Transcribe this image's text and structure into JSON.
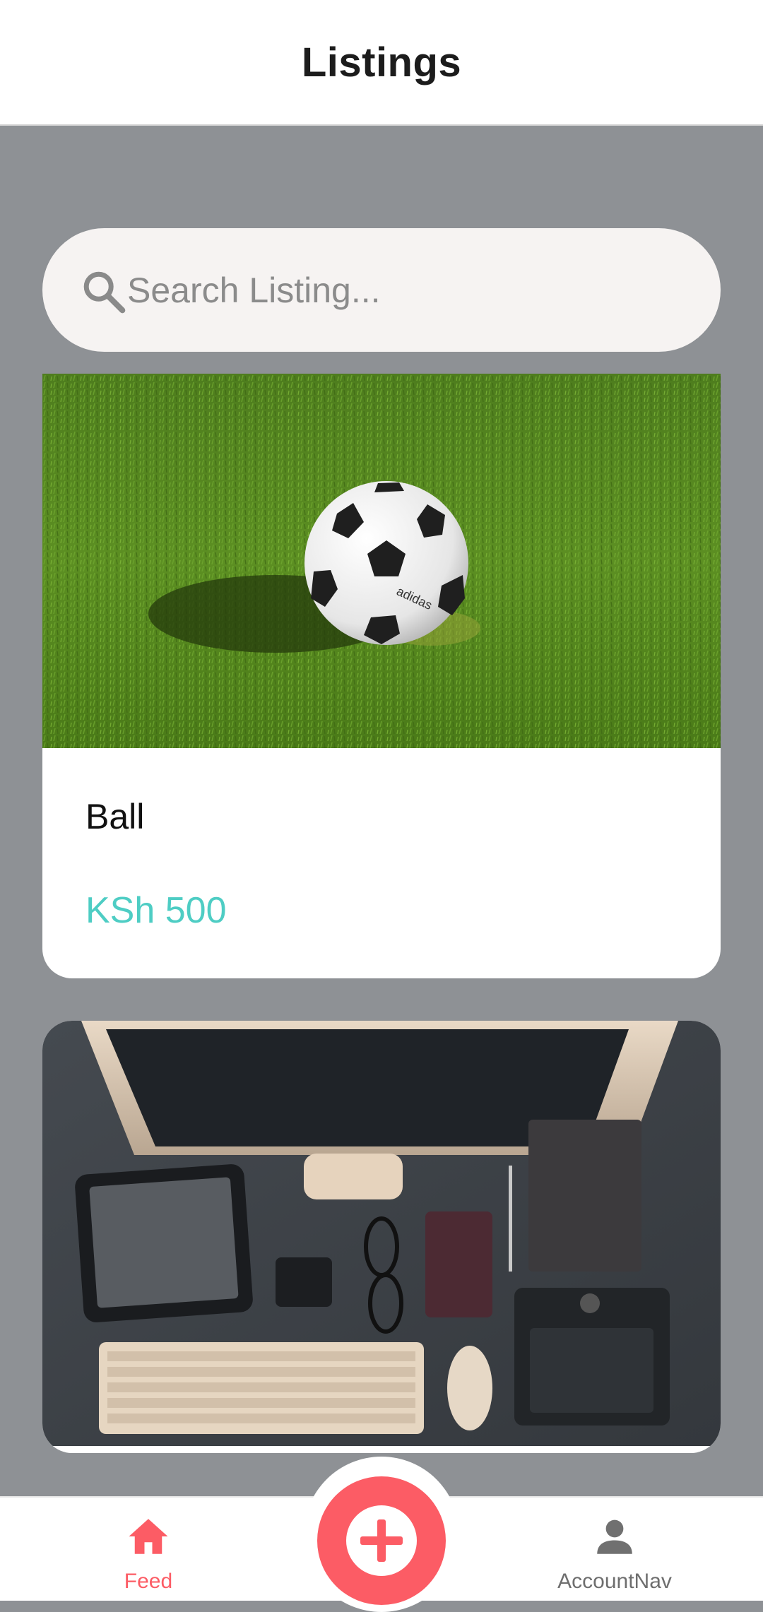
{
  "header": {
    "title": "Listings"
  },
  "search": {
    "placeholder": "Search Listing...",
    "icon": "search-icon"
  },
  "listings": [
    {
      "title": "Ball",
      "price": "KSh 500",
      "image": "soccer ball on grass"
    },
    {
      "title": "",
      "price": "",
      "image": "desk workspace with monitor, tablet, keyboard"
    }
  ],
  "tabbar": {
    "feed_label": "Feed",
    "account_label": "AccountNav",
    "fab_icon": "plus-circle-icon"
  },
  "colors": {
    "primary": "#fc5c65",
    "secondary": "#4ecdc4",
    "background": "#8e9195"
  }
}
